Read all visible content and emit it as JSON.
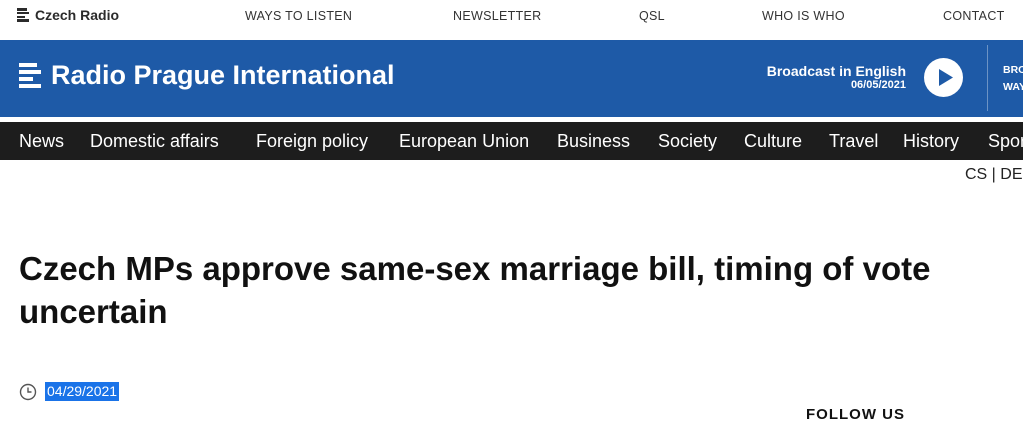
{
  "topbar": {
    "logo_label": "Czech Radio",
    "links": [
      "WAYS TO LISTEN",
      "NEWSLETTER",
      "QSL",
      "WHO IS WHO",
      "CONTACT"
    ]
  },
  "brand": {
    "title": "Radio Prague International",
    "broadcast_title": "Broadcast in English",
    "broadcast_date": "06/05/2021",
    "side_line1": "BRO",
    "side_line2": "WAY"
  },
  "sections": [
    "News",
    "Domestic affairs",
    "Foreign policy",
    "European Union",
    "Business",
    "Society",
    "Culture",
    "Travel",
    "History",
    "Spor"
  ],
  "language": "CS | DE",
  "article": {
    "title": "Czech MPs approve same-sex marriage bill, timing of vote uncertain",
    "date": "04/29/2021"
  },
  "sidebar": {
    "follow_label": "FOLLOW US"
  },
  "colors": {
    "brand_blue": "#1e5aa7",
    "nav_dark": "#1d1d1d",
    "selection": "#1a73e8"
  }
}
